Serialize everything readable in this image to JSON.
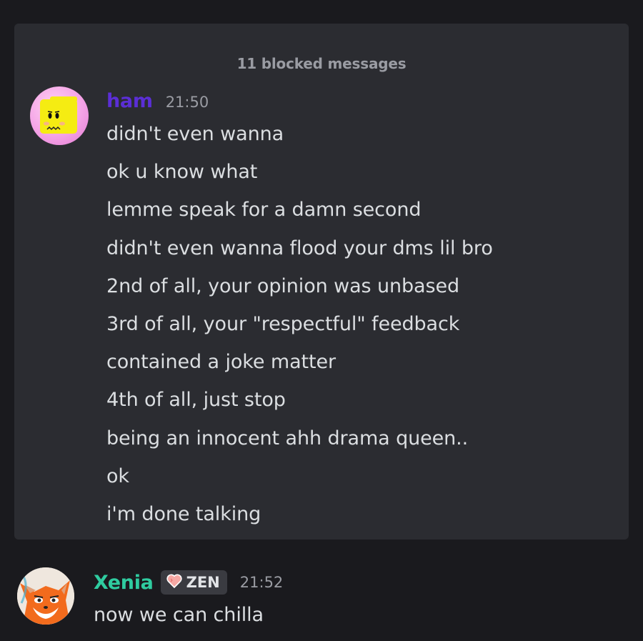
{
  "blocked": {
    "label": "11 blocked messages"
  },
  "ham": {
    "username": "ham",
    "timestamp": "21:50",
    "color": "#5b2ed6",
    "messages": [
      "didn't even wanna",
      "ok u know what",
      "lemme speak for a damn second",
      "didn't even wanna flood your dms lil bro",
      "2nd of all, your opinion was unbased",
      "3rd of all, your \"respectful\" feedback",
      "contained a joke matter",
      "4th of all, just stop",
      "being an innocent ahh drama queen..",
      "ok",
      "i'm done talking"
    ]
  },
  "xenia": {
    "username": "Xenia",
    "tag_icon": "heart-icon",
    "tag_label": "ZEN",
    "timestamp": "21:52",
    "color": "#2fcca0",
    "message": "now we can chilla"
  }
}
